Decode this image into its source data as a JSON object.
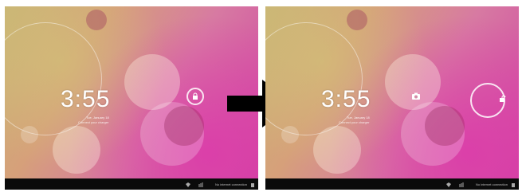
{
  "screens": [
    {
      "clock": "3:55",
      "date": "Tue, January 18",
      "owner": "Connect your charger"
    },
    {
      "clock": "3:55",
      "date": "Tue, January 18",
      "owner": "Connect your charger"
    }
  ],
  "status_bar": {
    "network_text": "No internet connection"
  },
  "icons": {
    "lock": "lock-icon",
    "unlock": "unlock-icon",
    "camera": "camera-icon",
    "arrow": "right-arrow-icon"
  },
  "colors": {
    "arrow": "#000000",
    "navbar": "#0b0b0b",
    "wallpaper_accent": "#cf3fa2"
  }
}
